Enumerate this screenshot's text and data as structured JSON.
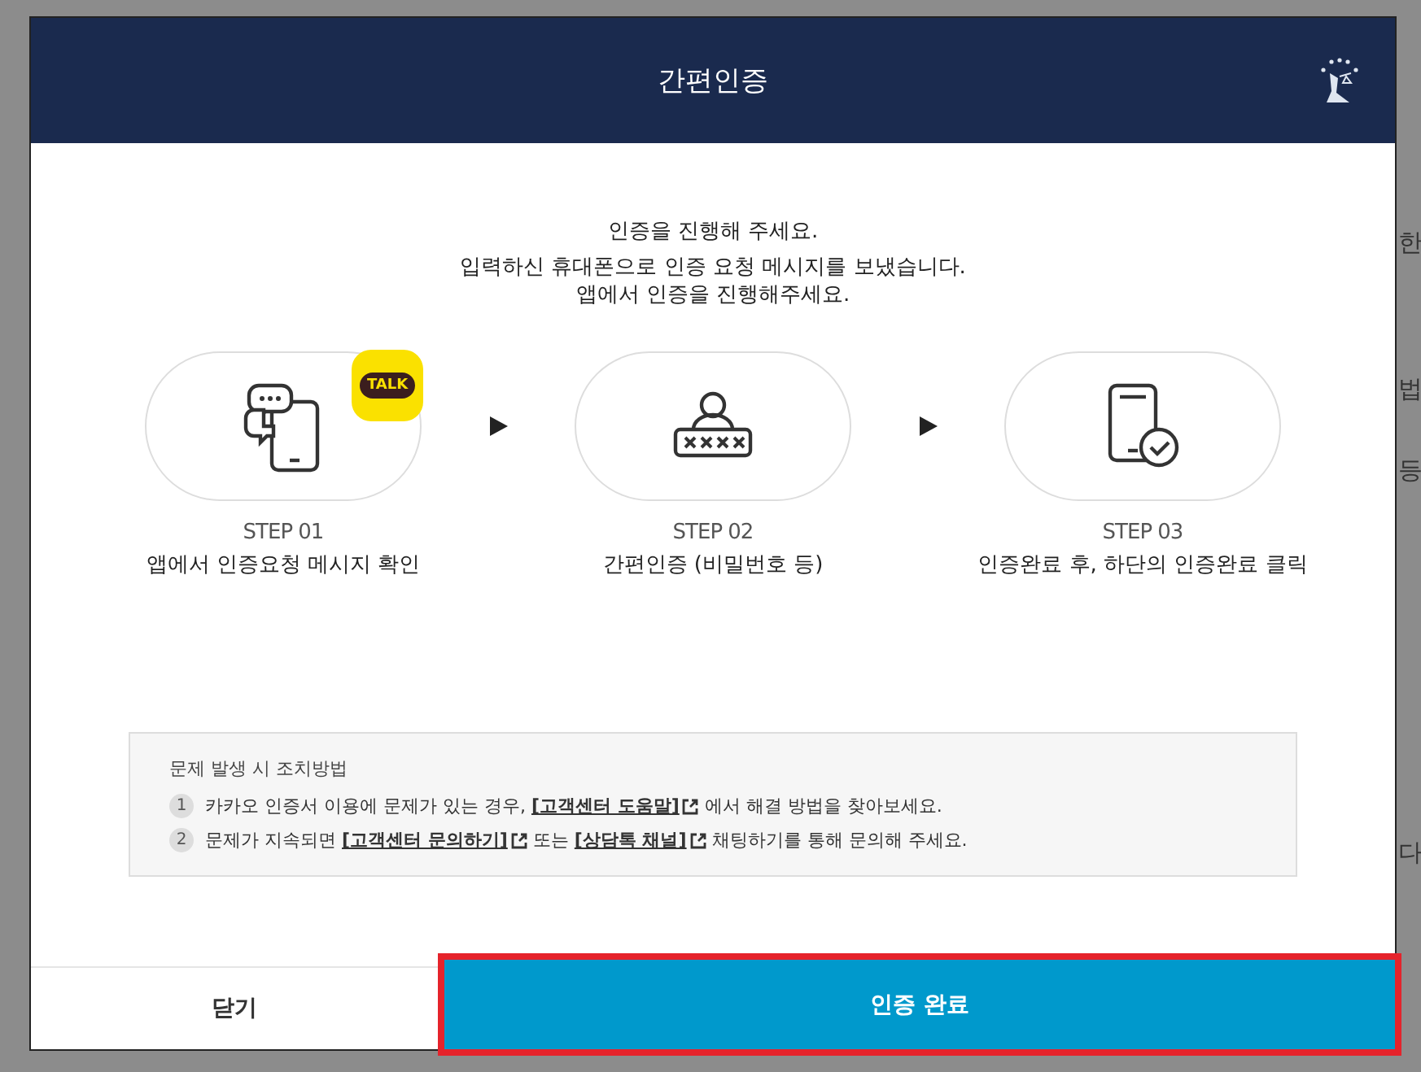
{
  "background_page": {
    "edge_fragments": [
      "한",
      "법",
      "등",
      "다"
    ]
  },
  "dialog": {
    "title": "간편인증",
    "intro": [
      "인증을 진행해 주세요.",
      "입력하신 휴대폰으로 인증 요청 메시지를 보냈습니다.",
      "앱에서 인증을 진행해주세요."
    ],
    "steps": [
      {
        "kind": "message",
        "step": "STEP 01",
        "label": "앱에서 인증요청 메시지 확인",
        "badge": "TALK"
      },
      {
        "kind": "password",
        "step": "STEP 02",
        "label": "간편인증 (비밀번호 등)"
      },
      {
        "kind": "done",
        "step": "STEP 03",
        "label": "인증완료 후, 하단의 인증완료 클릭"
      }
    ],
    "help": {
      "title": "문제 발생 시 조치방법",
      "items": [
        {
          "number": "1",
          "parts": [
            {
              "kind": "text",
              "text": "카카오 인증서 이용에 문제가 있는 경우, "
            },
            {
              "kind": "link",
              "text": "[고객센터 도움말]"
            },
            {
              "kind": "text",
              "text": " 에서 해결 방법을 찾아보세요."
            }
          ]
        },
        {
          "number": "2",
          "parts": [
            {
              "kind": "text",
              "text": "문제가 지속되면 "
            },
            {
              "kind": "link",
              "text": "[고객센터 문의하기]"
            },
            {
              "kind": "text",
              "text": " 또는 "
            },
            {
              "kind": "link",
              "text": "[상담톡 채널]"
            },
            {
              "kind": "text",
              "text": " 채팅하기를 통해 문의해 주세요."
            }
          ]
        }
      ]
    },
    "buttons": [
      {
        "kind": "close",
        "label": "닫기",
        "highlighted": false
      },
      {
        "kind": "confirm",
        "label": "인증 완료",
        "highlighted": true
      }
    ]
  }
}
